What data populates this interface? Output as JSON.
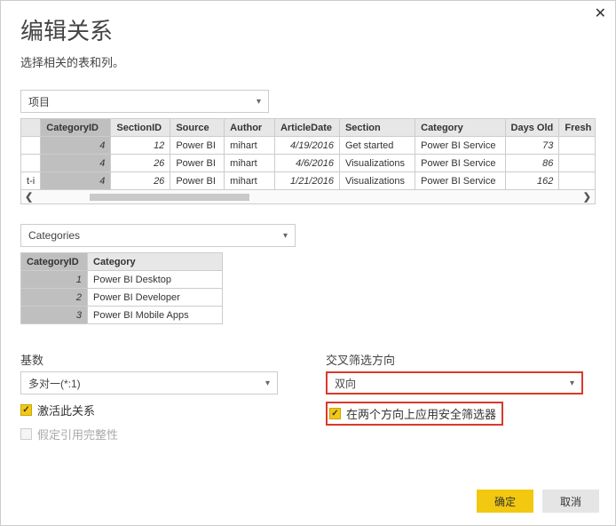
{
  "close": "✕",
  "title": "编辑关系",
  "subtitle": "选择相关的表和列。",
  "dropdown1": "项目",
  "table1": {
    "headers": [
      "",
      "CategoryID",
      "SectionID",
      "Source",
      "Author",
      "ArticleDate",
      "Section",
      "Category",
      "Days Old",
      "Fresh"
    ],
    "rows": [
      [
        "",
        "4",
        "12",
        "Power BI",
        "mihart",
        "4/19/2016",
        "Get started",
        "Power BI Service",
        "73",
        ""
      ],
      [
        "",
        "4",
        "26",
        "Power BI",
        "mihart",
        "4/6/2016",
        "Visualizations",
        "Power BI Service",
        "86",
        ""
      ],
      [
        "t-i",
        "4",
        "26",
        "Power BI",
        "mihart",
        "1/21/2016",
        "Visualizations",
        "Power BI Service",
        "162",
        ""
      ]
    ]
  },
  "dropdown2": "Categories",
  "table2": {
    "headers": [
      "CategoryID",
      "Category"
    ],
    "rows": [
      [
        "1",
        "Power BI Desktop"
      ],
      [
        "2",
        "Power BI Developer"
      ],
      [
        "3",
        "Power BI Mobile Apps"
      ]
    ]
  },
  "cardinality": {
    "label": "基数",
    "value": "多对一(*:1)"
  },
  "cross_filter": {
    "label": "交叉筛选方向",
    "value": "双向"
  },
  "activate": "激活此关系",
  "apply_both": "在两个方向上应用安全筛选器",
  "assume_ref": "假定引用完整性",
  "ok": "确定",
  "cancel": "取消"
}
